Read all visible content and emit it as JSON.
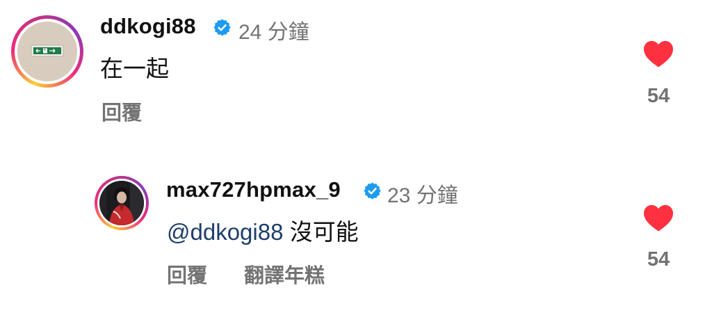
{
  "comments": [
    {
      "username": "ddkogi88",
      "verified_icon": "verified-badge-icon",
      "time": "24 分鐘",
      "text": "在一起",
      "reply_label": "回覆",
      "like_icon": "heart-filled-icon",
      "likes": "54"
    },
    {
      "username": "max727hpmax_9",
      "verified_icon": "verified-badge-icon",
      "time": "23 分鐘",
      "mention": "@ddkogi88",
      "text": "沒可能",
      "reply_label": "回覆",
      "translate_label": "翻譯年糕",
      "like_icon": "heart-filled-icon",
      "likes": "54"
    }
  ],
  "colors": {
    "verified": "#1d9bf0",
    "heart": "#ff3040",
    "secondary_text": "#737373",
    "mention": "#1e3e6b"
  }
}
